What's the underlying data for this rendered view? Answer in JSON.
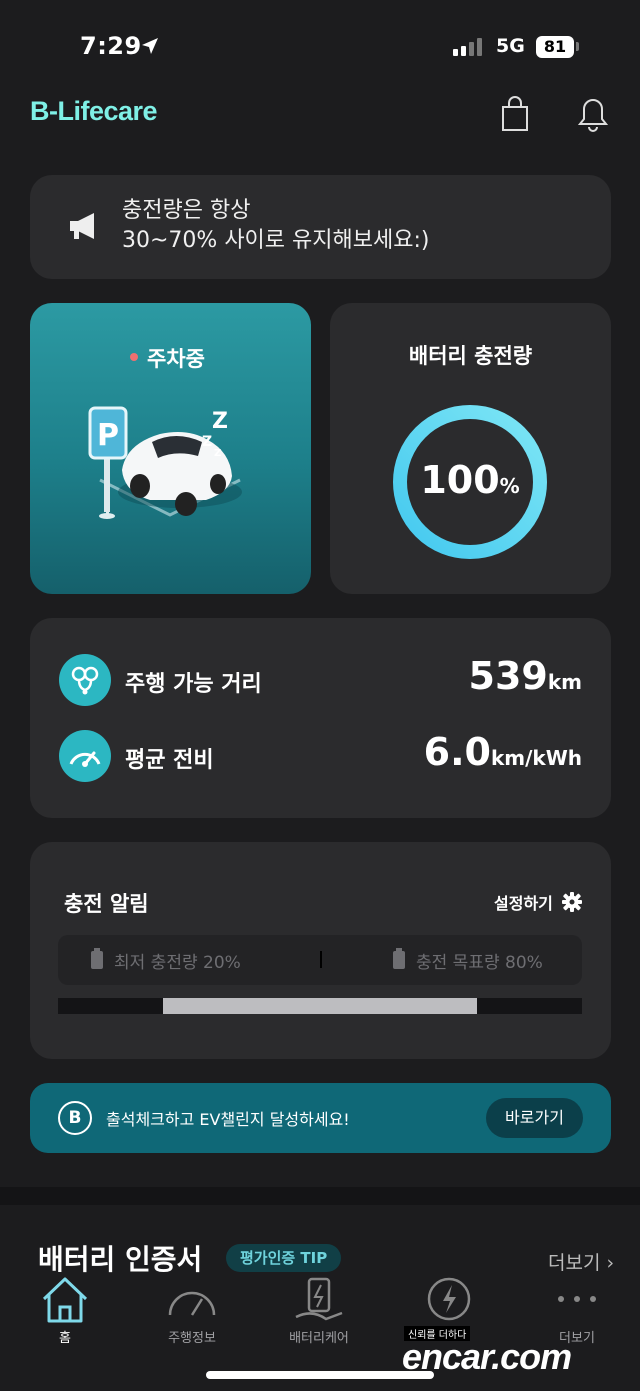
{
  "status_bar": {
    "time": "7:29",
    "network": "5G",
    "battery": "81"
  },
  "header": {
    "logo": "B-Lifecare",
    "icons": [
      "shopping-bag-icon",
      "bell-icon"
    ]
  },
  "notice": {
    "line1": "충전량은 항상",
    "line2": "30~70% 사이로 유지해보세요:)"
  },
  "parking": {
    "status": "주차중",
    "status_dot_color": "#f07070"
  },
  "battery": {
    "title": "배터리 충전량",
    "value": "100",
    "unit": "%",
    "level": 1.0,
    "ring_color": "#5fd6f2"
  },
  "stats": {
    "range_label": "주행 가능 거리",
    "range_value": "539",
    "range_unit": "km",
    "efficiency_label": "평균 전비",
    "efficiency_value": "6.0",
    "efficiency_unit": "km/kWh"
  },
  "charge_alert": {
    "title": "충전 알림",
    "settings_label": "설정하기",
    "min_label": "최저 충전량 20%",
    "max_label": "충전 목표량 80%",
    "range_start": 0.2,
    "range_end": 0.8
  },
  "banner": {
    "badge": "B",
    "text": "출석체크하고 EV챌린지 달성하세요!",
    "button": "바로가기"
  },
  "certificate": {
    "title": "배터리 인증서",
    "tip": "평가인증 TIP",
    "more": "더보기 ›"
  },
  "tabs": [
    {
      "label": "홈",
      "icon": "home-icon"
    },
    {
      "label": "주행정보",
      "icon": "speedometer-icon"
    },
    {
      "label": "배터리케어",
      "icon": "battery-care-icon"
    },
    {
      "label": "",
      "icon": "charge-icon"
    },
    {
      "label": "더보기",
      "icon": "more-icon"
    }
  ],
  "watermark": {
    "small": "신뢰를 더하다",
    "big": "encar.com"
  },
  "colors": {
    "accent": "#2cb7c2",
    "background": "#1c1c1e",
    "card": "#2b2b2d",
    "banner": "#0f6877"
  }
}
